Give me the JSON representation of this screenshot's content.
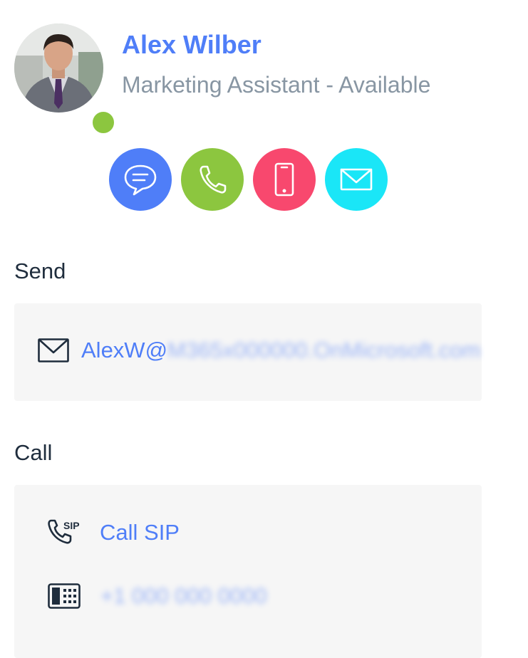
{
  "profile": {
    "name": "Alex Wilber",
    "subtitle": "Marketing Assistant - Available",
    "presence_color": "#8cc63f"
  },
  "actions": [
    {
      "name": "chat",
      "icon": "chat-icon",
      "color": "#4f7ef8"
    },
    {
      "name": "call",
      "icon": "phone-icon",
      "color": "#8cc63f"
    },
    {
      "name": "mobile",
      "icon": "mobile-icon",
      "color": "#f8486e"
    },
    {
      "name": "email",
      "icon": "mail-icon",
      "color": "#1ae6f7"
    }
  ],
  "send": {
    "heading": "Send",
    "email_prefix": "AlexW@",
    "email_domain_redacted": "M365x000000.OnMicrosoft.com",
    "icon": "mail-icon"
  },
  "call": {
    "heading": "Call",
    "sip_label": "Call SIP",
    "sip_icon": "sip-phone-icon",
    "phone_redacted": "+1 000 000 0000",
    "phone_icon": "desk-phone-icon"
  },
  "colors": {
    "accent": "#4f7ef8",
    "heading": "#1f2d3d",
    "subtitle": "#8896a3",
    "card_bg": "#f6f6f6"
  }
}
